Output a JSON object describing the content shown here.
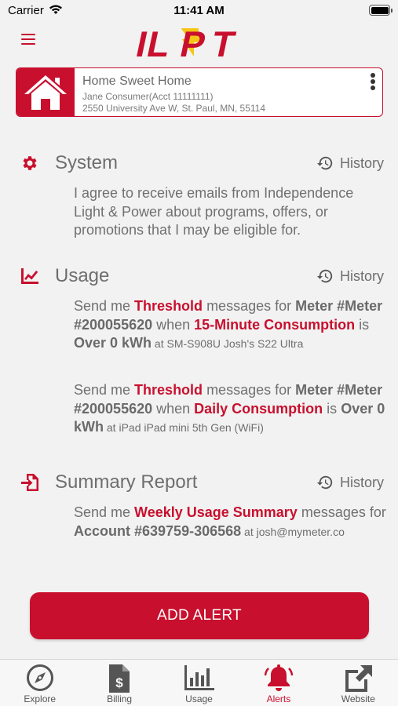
{
  "status_bar": {
    "carrier": "Carrier",
    "time": "11:41 AM"
  },
  "header": {
    "logo_text": "ILPT"
  },
  "account": {
    "name": "Home Sweet Home",
    "consumer": "Jane Consumer(Acct 11111111)",
    "address": "2550 University Ave W, St. Paul, MN, 55114"
  },
  "sections": {
    "system": {
      "title": "System",
      "history": "History",
      "text": "I agree to receive emails from Independence Light & Power about programs, offers, or promotions that I may be eligible for."
    },
    "usage": {
      "title": "Usage",
      "history": "History",
      "alerts": [
        {
          "p1": "Send me ",
          "type": "Threshold",
          "p2": " messages for ",
          "meter": "Meter #Meter #200055620",
          "p3": " when ",
          "metric": "15-Minute Consumption",
          "p4": " is ",
          "condition": "Over 0 kWh",
          "p5": " at ",
          "device": "SM-S908U Josh's S22 Ultra"
        },
        {
          "p1": "Send me ",
          "type": "Threshold",
          "p2": " messages for ",
          "meter": "Meter #Meter #200055620",
          "p3": " when ",
          "metric": "Daily Consumption",
          "p4": " is ",
          "condition": "Over 0 kWh",
          "p5": " at ",
          "device": "iPad iPad mini 5th Gen (WiFi)"
        }
      ]
    },
    "summary": {
      "title": "Summary Report",
      "history": "History",
      "p1": "Send me ",
      "report": "Weekly Usage Summary",
      "p2": " messages for ",
      "account": "Account #639759-306568",
      "p3": " at ",
      "email": "josh@mymeter.co"
    }
  },
  "add_alert_label": "ADD ALERT",
  "tabs": [
    {
      "label": "Explore",
      "icon": "compass-icon",
      "active": false
    },
    {
      "label": "Billing",
      "icon": "bill-icon",
      "active": false
    },
    {
      "label": "Usage",
      "icon": "bar-chart-icon",
      "active": false
    },
    {
      "label": "Alerts",
      "icon": "bell-icon",
      "active": true
    },
    {
      "label": "Website",
      "icon": "external-link-icon",
      "active": false
    }
  ],
  "colors": {
    "brand_red": "#c8102e",
    "background": "#f2f2f2",
    "logo_yellow": "#f5c518"
  }
}
